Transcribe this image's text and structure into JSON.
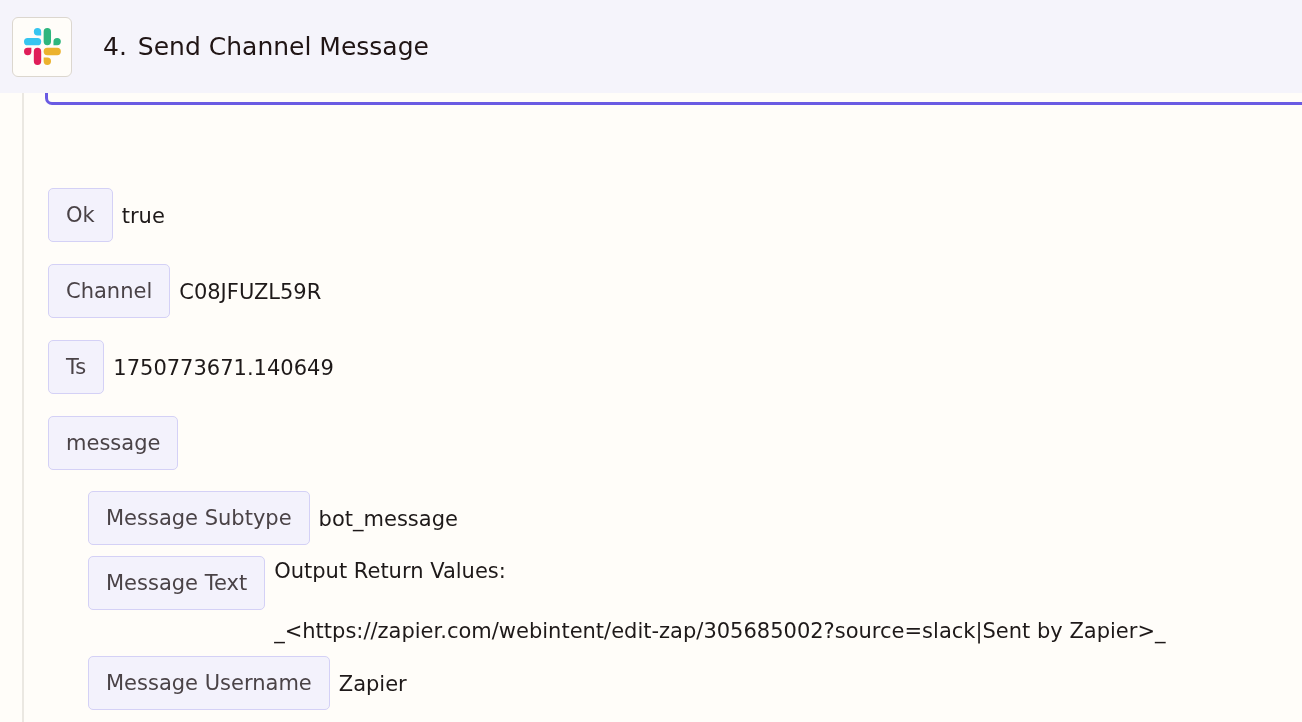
{
  "header": {
    "step_number": "4.",
    "title": "Send Channel Message"
  },
  "fields": [
    {
      "label": "Ok",
      "value": "true"
    },
    {
      "label": "Channel",
      "value": "C08JFUZL59R"
    },
    {
      "label": "Ts",
      "value": "1750773671.140649"
    },
    {
      "label": "message",
      "children": [
        {
          "label": "Message Subtype",
          "value": "bot_message"
        },
        {
          "label": "Message Text",
          "value": "Output Return Values:\n\n_<https://zapier.com/webintent/edit-zap/305685002?source=slack|Sent by Zapier>_"
        },
        {
          "label": "Message Username",
          "value": "Zapier"
        }
      ]
    }
  ]
}
